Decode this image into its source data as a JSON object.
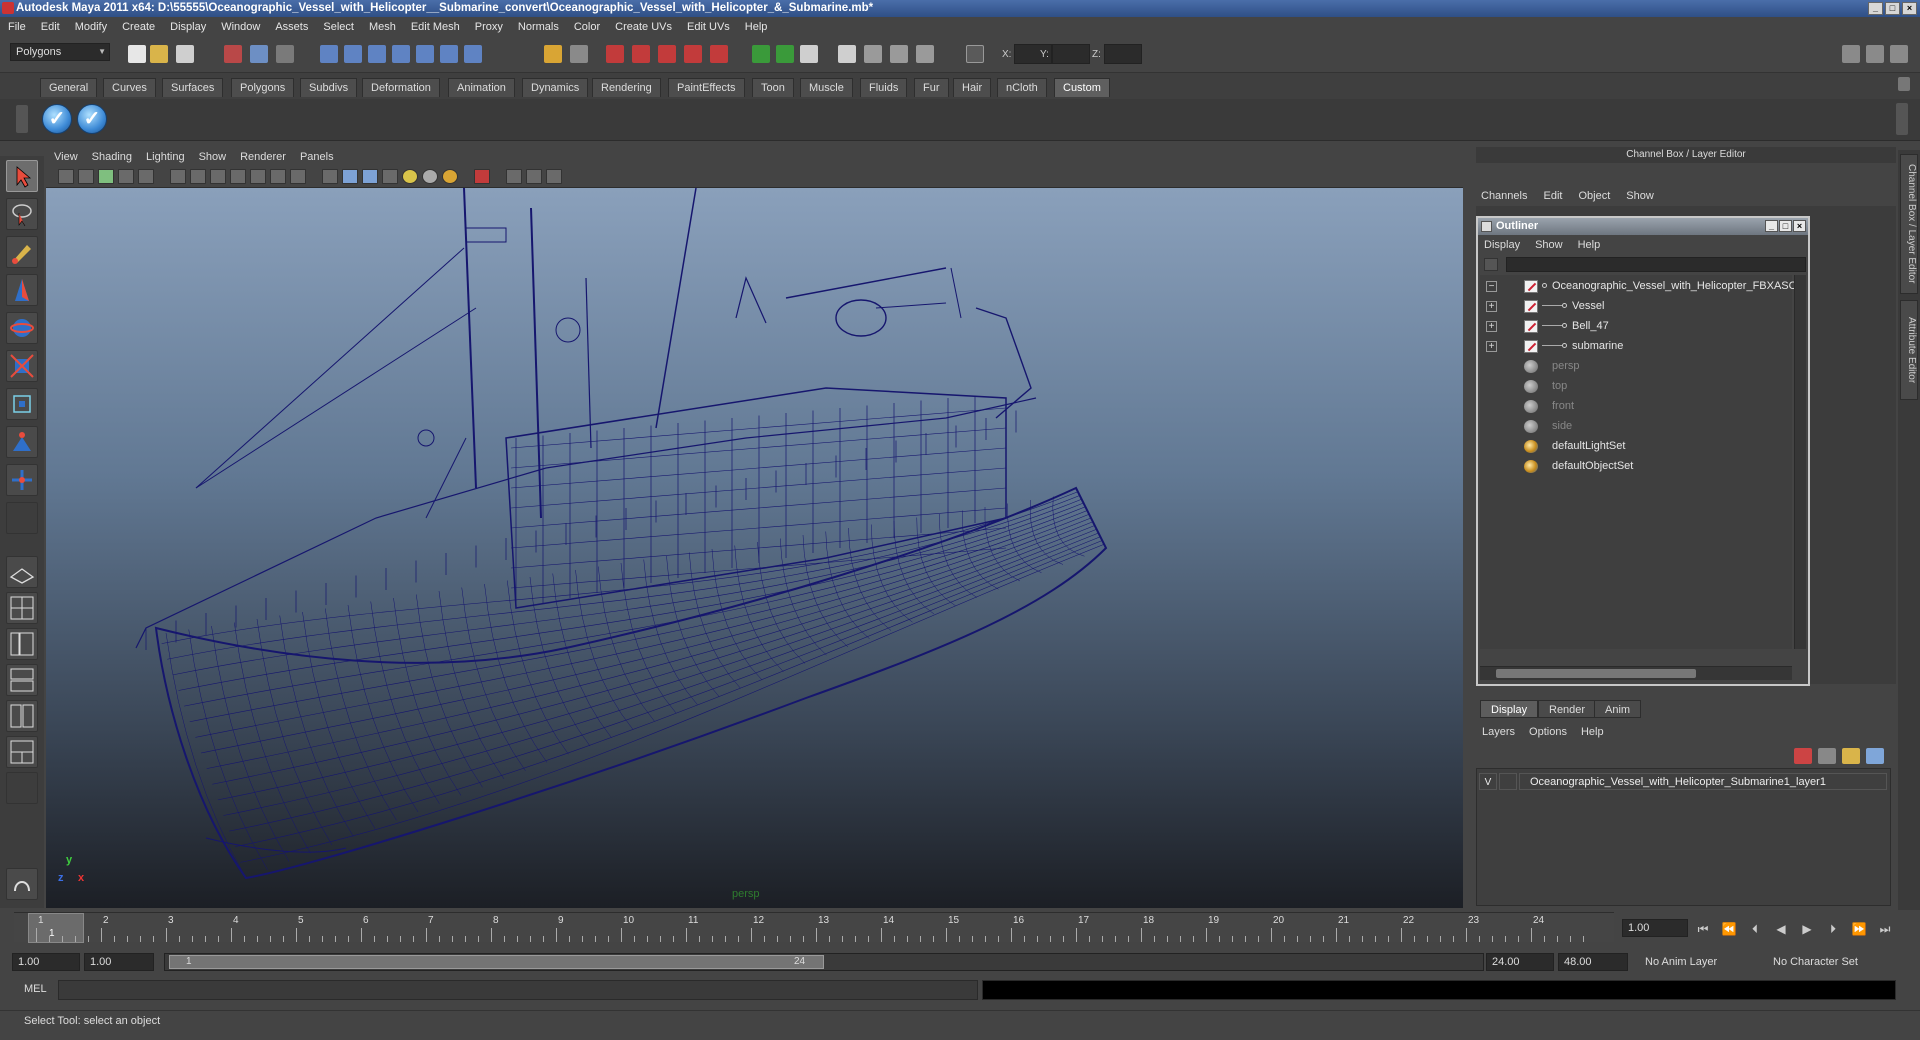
{
  "window": {
    "title": "Autodesk Maya 2011 x64: D:\\55555\\Oceanographic_Vessel_with_Helicopter__Submarine_convert\\Oceanographic_Vessel_with_Helicopter_&_Submarine.mb*",
    "minimize": "_",
    "maximize": "□",
    "close": "×"
  },
  "menubar": [
    "File",
    "Edit",
    "Modify",
    "Create",
    "Display",
    "Window",
    "Assets",
    "Select",
    "Mesh",
    "Edit Mesh",
    "Proxy",
    "Normals",
    "Color",
    "Create UVs",
    "Edit UVs",
    "Help"
  ],
  "statusline": {
    "mode": "Polygons",
    "x_label": "X:",
    "y_label": "Y:",
    "z_label": "Z:"
  },
  "shelf": {
    "tabs": [
      "General",
      "Curves",
      "Surfaces",
      "Polygons",
      "Subdivs",
      "Deformation",
      "Animation",
      "Dynamics",
      "Rendering",
      "PaintEffects",
      "Toon",
      "Muscle",
      "Fluids",
      "Fur",
      "Hair",
      "nCloth",
      "Custom"
    ],
    "active_tab": "Custom",
    "check_glyph": "✓"
  },
  "viewport": {
    "menu": [
      "View",
      "Shading",
      "Lighting",
      "Show",
      "Renderer",
      "Panels"
    ],
    "camera_label": "persp",
    "axis_y": "y",
    "axis_x": "x",
    "axis_z": "z",
    "wire_color": "#16166e"
  },
  "channel_box": {
    "header": "Channel Box / Layer Editor",
    "menu": [
      "Channels",
      "Edit",
      "Object",
      "Show"
    ]
  },
  "outliner": {
    "title": "Outliner",
    "menu": [
      "Display",
      "Show",
      "Help"
    ],
    "rows": [
      {
        "label": "Oceanographic_Vessel_with_Helicopter_FBXASC0",
        "expander": "−",
        "icon": "transform",
        "dim": false
      },
      {
        "label": "Vessel",
        "expander": "+",
        "icon": "transform",
        "dim": false
      },
      {
        "label": "Bell_47",
        "expander": "+",
        "icon": "transform",
        "dim": false
      },
      {
        "label": "submarine",
        "expander": "+",
        "icon": "transform",
        "dim": false
      },
      {
        "label": "persp",
        "expander": "",
        "icon": "camera",
        "dim": true
      },
      {
        "label": "top",
        "expander": "",
        "icon": "camera",
        "dim": true
      },
      {
        "label": "front",
        "expander": "",
        "icon": "camera",
        "dim": true
      },
      {
        "label": "side",
        "expander": "",
        "icon": "camera",
        "dim": true
      },
      {
        "label": "defaultLightSet",
        "expander": "",
        "icon": "set",
        "dim": false
      },
      {
        "label": "defaultObjectSet",
        "expander": "",
        "icon": "set",
        "dim": false
      }
    ]
  },
  "layer_editor": {
    "tabs": [
      "Display",
      "Render",
      "Anim"
    ],
    "active_tab": "Display",
    "menu": [
      "Layers",
      "Options",
      "Help"
    ],
    "layer": {
      "visible": "V",
      "name": "Oceanographic_Vessel_with_Helicopter_Submarine1_layer1"
    }
  },
  "side_tabs": [
    "Channel Box / Layer Editor",
    "Attribute Editor"
  ],
  "timeline": {
    "frames": [
      "1",
      "2",
      "3",
      "4",
      "5",
      "6",
      "7",
      "8",
      "9",
      "10",
      "11",
      "12",
      "13",
      "14",
      "15",
      "16",
      "17",
      "18",
      "19",
      "20",
      "21",
      "22",
      "23",
      "24"
    ],
    "current_frame_label": "1",
    "current_time": "1.00",
    "transport": [
      "⏮",
      "⏪",
      "⏴",
      "◀",
      "▶",
      "⏵",
      "⏩",
      "⏭"
    ]
  },
  "range": {
    "start": "1.00",
    "playback_start": "1.00",
    "slider_start": "1",
    "slider_end": "24",
    "playback_end": "24.00",
    "end": "48.00",
    "anim_layer": "No Anim Layer",
    "char_set": "No Character Set"
  },
  "command_line": {
    "label": "MEL"
  },
  "help_line": {
    "text": "Select Tool: select an object"
  }
}
